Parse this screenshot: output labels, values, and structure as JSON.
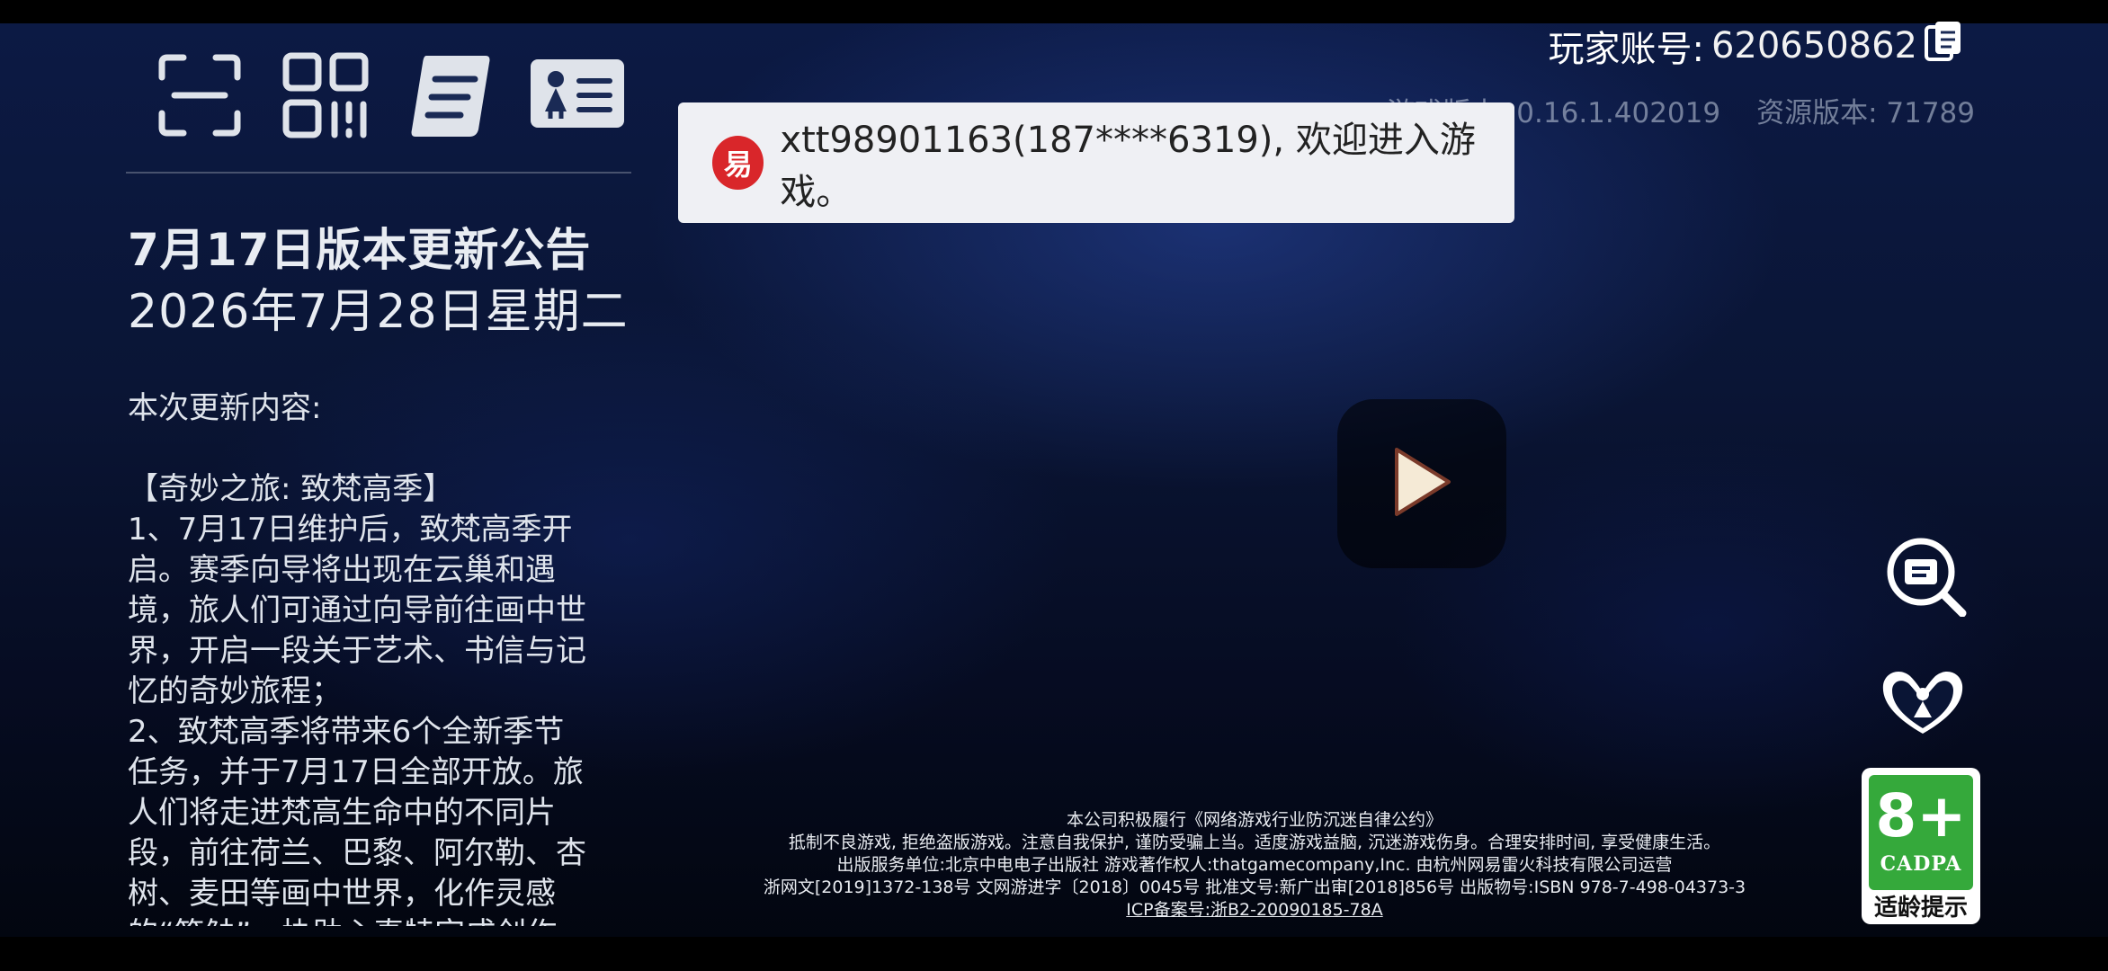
{
  "account": {
    "label": "玩家账号: ",
    "id": "620650862"
  },
  "versions": {
    "game": "游戏版本: 0.16.1.402019",
    "resource": "资源版本: 71789"
  },
  "toast": {
    "logo_text": "易",
    "message": "xtt98901163(187****6319), 欢迎进入游戏。"
  },
  "announcement": {
    "title": "7月17日版本更新公告",
    "date": "2026年7月28日星期二",
    "lines": [
      "本次更新内容:",
      "",
      "【奇妙之旅: 致梵高季】",
      "1、7月17日维护后，致梵高季开",
      "启。赛季向导将出现在云巢和遇",
      "境，旅人们可通过向导前往画中世",
      "界，开启一段关于艺术、书信与记",
      "忆的奇妙旅程；",
      "2、致梵高季将带来6个全新季节",
      "任务，并于7月17日全部开放。旅",
      "人们将走进梵高生命中的不同片",
      "段，前往荷兰、巴黎、阿尔勒、杏",
      "树、麦田等画中世界，化作灵感",
      "的“笔触”，协助心真特完成创作"
    ]
  },
  "rating": {
    "age": "8+",
    "org": "CADPA",
    "tip": "适龄提示"
  },
  "legal": {
    "line1": "本公司积极履行《网络游戏行业防沉迷自律公约》",
    "line2": "抵制不良游戏, 拒绝盗版游戏。注意自我保护, 谨防受骗上当。适度游戏益脑, 沉迷游戏伤身。合理安排时间, 享受健康生活。",
    "line3": "出版服务单位:北京中电电子出版社  游戏著作权人:thatgamecompany,Inc.  由杭州网易雷火科技有限公司运营",
    "line4": "浙网文[2019]1372-138号  文网游进字〔2018〕0045号  批准文号:新广出审[2018]856号  出版物号:ISBN 978-7-498-04373-3",
    "icp": "ICP备案号:浙B2-20090185-78A"
  },
  "icons": {
    "scan": "scan-icon",
    "qr": "qr-code-icon",
    "scroll": "notice-scroll-icon",
    "id_card": "id-card-icon",
    "copy": "copy-icon",
    "play": "play-icon",
    "search_doc": "search-document-icon",
    "family": "family-guardian-icon"
  },
  "colors": {
    "accent_red": "#d9262a",
    "rating_green": "#35a93b"
  }
}
